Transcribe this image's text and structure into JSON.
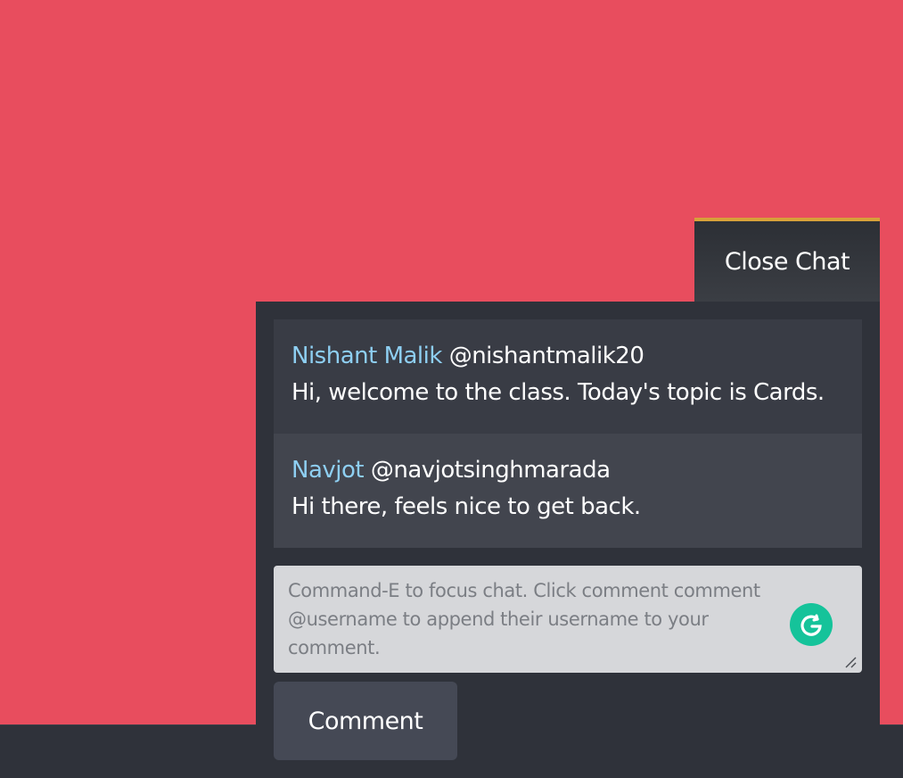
{
  "chat": {
    "close_label": "Close Chat",
    "messages": [
      {
        "author": "Nishant Malik",
        "handle": "@nishantmalik20",
        "text": "Hi, welcome to the class. Today's topic is Cards."
      },
      {
        "author": "Navjot",
        "handle": "@navjotsinghmarada",
        "text": "Hi there, feels nice to get back."
      }
    ],
    "composer": {
      "placeholder": "Command-E to focus chat. Click comment comment @username to append their username to your comment.",
      "value": ""
    },
    "comment_label": "Comment"
  },
  "icons": {
    "grammarly": "grammarly-icon",
    "resize": "resize-handle-icon"
  },
  "colors": {
    "background": "#e84d5e",
    "panel": "#2f323a",
    "author": "#8ecff2",
    "tab_accent": "#d7a13a",
    "grammarly": "#15c39a"
  }
}
